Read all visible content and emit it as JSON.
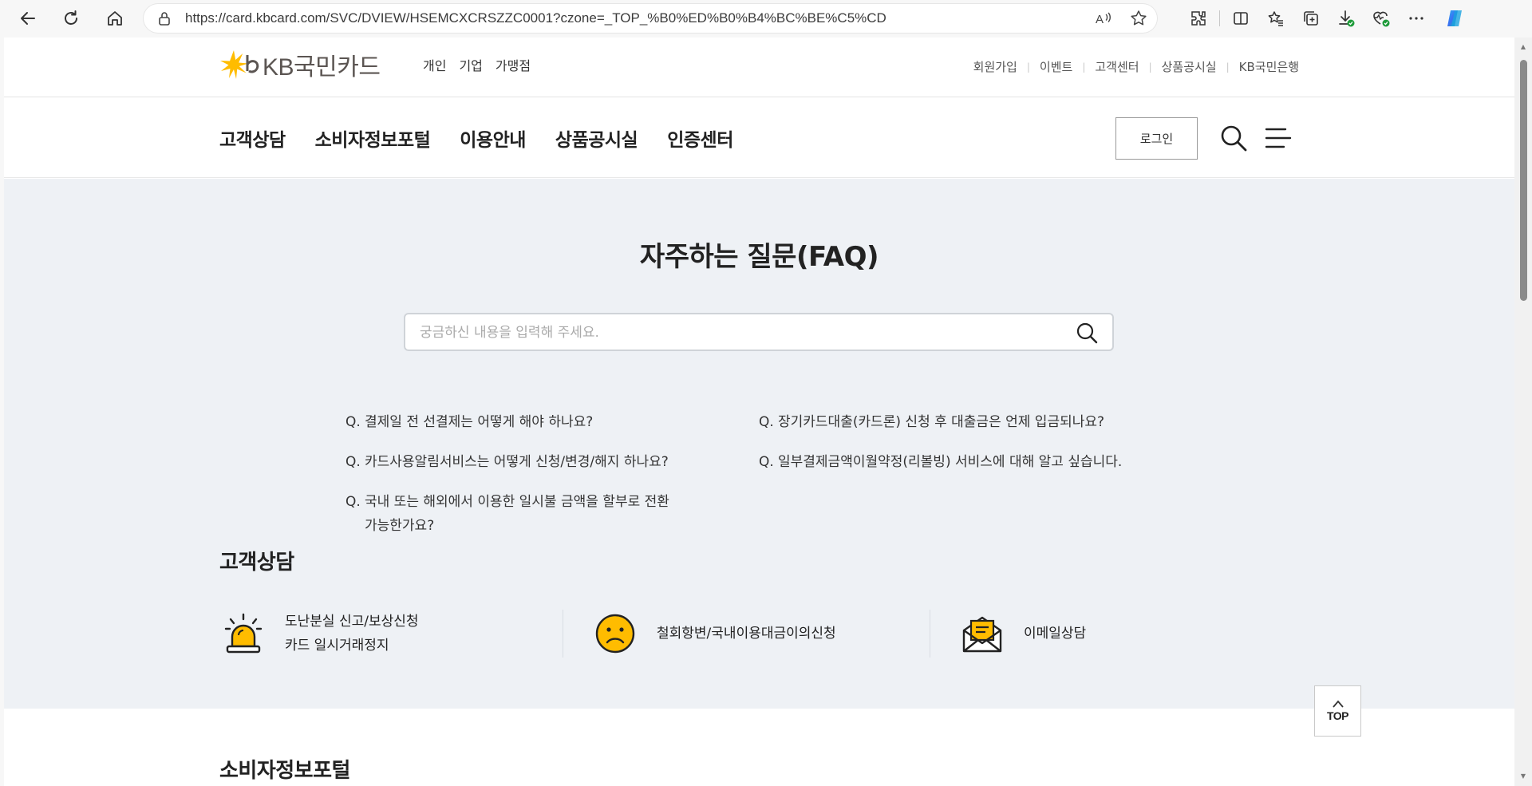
{
  "browser": {
    "url": "https://card.kbcard.com/SVC/DVIEW/HSEMCXCRSZZC0001?czone=_TOP_%B0%ED%B0%B4%BC%BE%C5%CD"
  },
  "header": {
    "logo_text": "KB국민카드",
    "segments": [
      "개인",
      "기업",
      "가맹점"
    ],
    "util_links": [
      "회원가입",
      "이벤트",
      "고객센터",
      "상품공시실",
      "KB국민은행"
    ]
  },
  "gnb": {
    "menu": [
      "고객상담",
      "소비자정보포털",
      "이용안내",
      "상품공시실",
      "인증센터"
    ],
    "login_label": "로그인"
  },
  "faq": {
    "title": "자주하는 질문(FAQ)",
    "search_placeholder": "궁금하신 내용을 입력해 주세요.",
    "q_prefix": "Q.",
    "questions": [
      "결제일 전 선결제는 어떻게 해야 하나요?",
      "장기카드대출(카드론) 신청 후 대출금은 언제 입금되나요?",
      "카드사용알림서비스는 어떻게 신청/변경/해지 하나요?",
      "일부결제금액이월약정(리볼빙) 서비스에 대해 알고 싶습니다.",
      "국내 또는 해외에서 이용한 일시불 금액을 할부로 전환",
      "가능한가요?"
    ]
  },
  "consult": {
    "title": "고객상담",
    "items": [
      {
        "line1": "도난분실 신고/보상신청",
        "line2": "카드 일시거래정지",
        "icon": "siren-icon"
      },
      {
        "line1": "철회항변/국내이용대금이의신청",
        "icon": "sad-face-icon"
      },
      {
        "line1": "이메일상담",
        "icon": "email-icon"
      }
    ]
  },
  "top_button": "TOP",
  "portal_title": "소비자정보포털",
  "colors": {
    "accent": "#ffbc00",
    "faq_bg": "#eef1f5"
  }
}
